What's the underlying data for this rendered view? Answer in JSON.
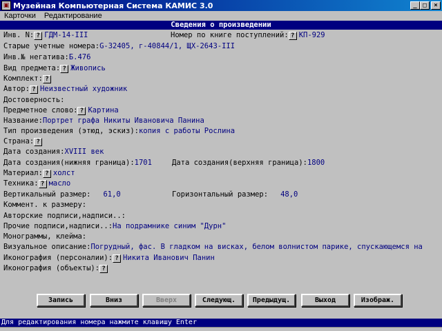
{
  "window": {
    "title": "Музейная Компьютерная Система КАМИС 3.0",
    "minimize": "_",
    "maximize": "□",
    "close": "×"
  },
  "menu": {
    "items": [
      {
        "label": "Карточки"
      },
      {
        "label": "Редактирование"
      }
    ]
  },
  "header": {
    "title": "Сведения о произведении"
  },
  "qmark": "?",
  "fields": {
    "inv_label": "Инв. N:",
    "inv_value": "ГДМ-14-III",
    "book_label": "Номер по книге поступлений:",
    "book_value": "КП-929",
    "old_label": "Старые учетные номера:",
    "old_value": "G-32405, г-40844/1, ЩХ-2643-III",
    "neg_label": "Инв.№ негатива:",
    "neg_value": "Б.476",
    "kind_label": "Вид предмета:",
    "kind_value": "Живопись",
    "set_label": "Комплект:",
    "author_label": "Автор:",
    "author_value": "Неизвестный художник",
    "reliab_label": "Достоверность:",
    "subject_label": "Предметное слово:",
    "subject_value": "Картина",
    "name_label": "Название:",
    "name_value": "Портрет графа Никиты Ивановича Панина",
    "type_label": "Тип произведения (этюд, эскиз):",
    "type_value": "копия с работы Рослина",
    "country_label": "Страна:",
    "date_label": "Дата создания:",
    "date_value": "XVIII век",
    "date_low_label": "Дата создания(нижняя граница):",
    "date_low_value": "1701",
    "date_high_label": "Дата создания(верхняя граница):",
    "date_high_value": "1800",
    "material_label": "Материал:",
    "material_value": "холст",
    "technique_label": "Техника:",
    "technique_value": "масло",
    "vsize_label": "Вертикальный размер:",
    "vsize_value": "61,0",
    "hsize_label": "Горизонтальный размер:",
    "hsize_value": "48,0",
    "size_comment_label": "Коммент. к размеру:",
    "author_sign_label": "Авторские подписи,надписи..:",
    "other_sign_label": "Прочие подписи,надписи..:",
    "other_sign_value": "На подрамнике синим \"Дурн\"",
    "monogram_label": "Монограммы, клейма:",
    "visual_label": "Визуальное описание:",
    "visual_value": "Погрудный, фас. В гладком на висках, белом волнистом парике, спускающемся на",
    "icon_pers_label": "Иконография (персоналии):",
    "icon_pers_value": "Никита Иванович Панин",
    "icon_obj_label": "Иконография (объекты):"
  },
  "buttons": {
    "save": "Запись",
    "down": "Вниз",
    "up": "Вверх",
    "next": "Следующ.",
    "prev": "Предыдущ.",
    "exit": "Выход",
    "image": "Изображ."
  },
  "status": {
    "text": "Для редактирования номера нажмите клавишу Enter"
  }
}
